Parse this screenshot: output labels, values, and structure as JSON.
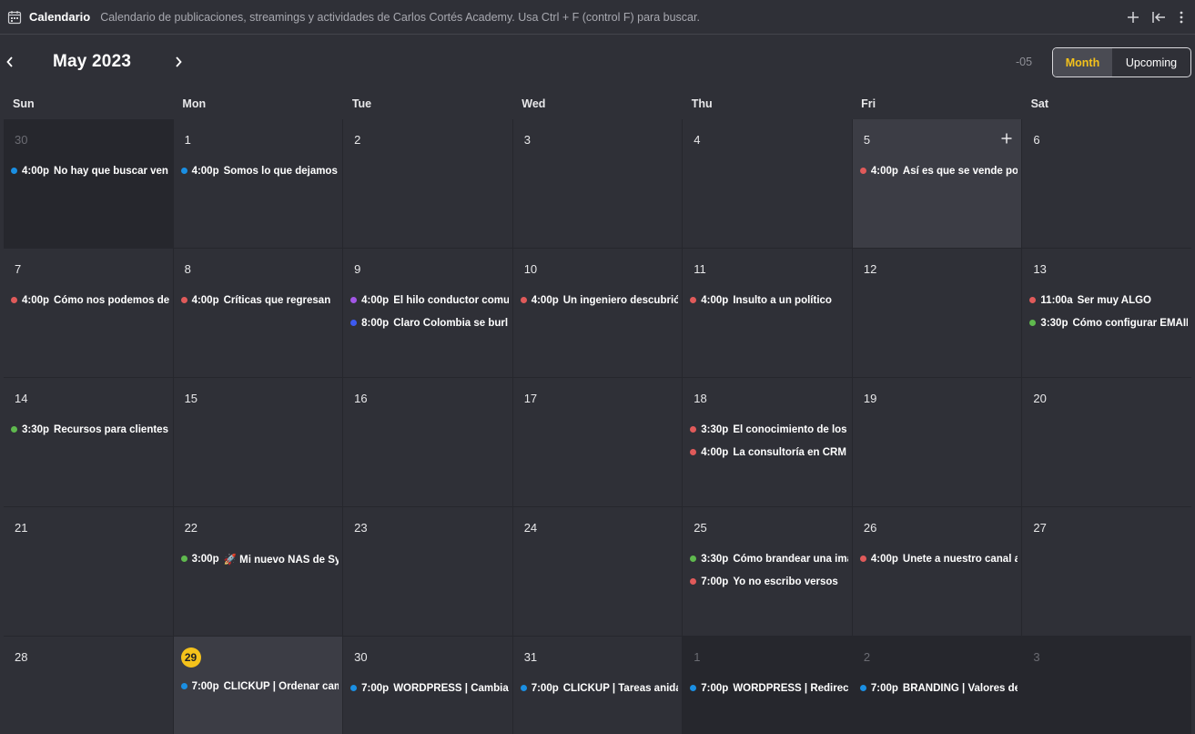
{
  "header": {
    "title": "Calendario",
    "description": "Calendario de publicaciones, streamings y actividades de Carlos Cortés Academy. Usa Ctrl + F (control F) para buscar."
  },
  "nav": {
    "month_title": "May 2023",
    "timezone": "-05",
    "view_month_label": "Month",
    "view_upcoming_label": "Upcoming"
  },
  "weekdays": [
    "Sun",
    "Mon",
    "Tue",
    "Wed",
    "Thu",
    "Fri",
    "Sat"
  ],
  "colors": {
    "blue": "#1a8fe3",
    "red": "#e05a5a",
    "purple": "#a256e6",
    "indigo": "#3d5af1",
    "green": "#5fb94e",
    "accent": "#f4c21b"
  },
  "days": [
    {
      "num": "30",
      "out": true,
      "events": [
        {
          "time": "4:00p",
          "title": "No hay que buscar ven",
          "color": "blue"
        }
      ]
    },
    {
      "num": "1",
      "events": [
        {
          "time": "4:00p",
          "title": "Somos lo que dejamos",
          "color": "blue"
        }
      ]
    },
    {
      "num": "2",
      "events": []
    },
    {
      "num": "3",
      "events": []
    },
    {
      "num": "4",
      "events": []
    },
    {
      "num": "5",
      "hover": true,
      "events": [
        {
          "time": "4:00p",
          "title": "Así es que se vende po",
          "color": "red"
        }
      ]
    },
    {
      "num": "6",
      "events": []
    },
    {
      "num": "7",
      "events": [
        {
          "time": "4:00p",
          "title": "Cómo nos podemos de",
          "color": "red"
        }
      ]
    },
    {
      "num": "8",
      "events": [
        {
          "time": "4:00p",
          "title": "Críticas que regresan",
          "color": "red"
        }
      ]
    },
    {
      "num": "9",
      "events": [
        {
          "time": "4:00p",
          "title": "El hilo conductor comu",
          "color": "purple"
        },
        {
          "time": "8:00p",
          "title": "Claro Colombia se burl",
          "color": "indigo"
        }
      ]
    },
    {
      "num": "10",
      "events": [
        {
          "time": "4:00p",
          "title": "Un ingeniero descubrió",
          "color": "red"
        }
      ]
    },
    {
      "num": "11",
      "events": [
        {
          "time": "4:00p",
          "title": "Insulto a un político",
          "color": "red"
        }
      ]
    },
    {
      "num": "12",
      "events": []
    },
    {
      "num": "13",
      "events": [
        {
          "time": "11:00a",
          "title": "Ser muy ALGO",
          "color": "red"
        },
        {
          "time": "3:30p",
          "title": "Cómo configurar EMAIL",
          "color": "green"
        }
      ]
    },
    {
      "num": "14",
      "events": [
        {
          "time": "3:30p",
          "title": "Recursos para clientes",
          "color": "green"
        }
      ]
    },
    {
      "num": "15",
      "events": []
    },
    {
      "num": "16",
      "events": []
    },
    {
      "num": "17",
      "events": []
    },
    {
      "num": "18",
      "events": [
        {
          "time": "3:30p",
          "title": "El conocimiento de los",
          "color": "red"
        },
        {
          "time": "4:00p",
          "title": "La consultoría en CRM",
          "color": "red"
        }
      ]
    },
    {
      "num": "19",
      "events": []
    },
    {
      "num": "20",
      "events": []
    },
    {
      "num": "21",
      "events": []
    },
    {
      "num": "22",
      "events": [
        {
          "time": "3:00p",
          "title": "🚀 Mi nuevo NAS de Sy",
          "color": "green"
        }
      ]
    },
    {
      "num": "23",
      "events": []
    },
    {
      "num": "24",
      "events": []
    },
    {
      "num": "25",
      "events": [
        {
          "time": "3:30p",
          "title": "Cómo brandear una ima",
          "color": "green"
        },
        {
          "time": "7:00p",
          "title": "Yo no escribo versos",
          "color": "red"
        }
      ]
    },
    {
      "num": "26",
      "events": [
        {
          "time": "4:00p",
          "title": "Únete a nuestro canal a",
          "color": "red"
        }
      ]
    },
    {
      "num": "27",
      "events": []
    },
    {
      "num": "28",
      "events": []
    },
    {
      "num": "29",
      "today": true,
      "events": [
        {
          "time": "7:00p",
          "title": "CLICKUP | Ordenar cam",
          "color": "blue"
        }
      ]
    },
    {
      "num": "30",
      "events": [
        {
          "time": "7:00p",
          "title": "WORDPRESS | Cambiar",
          "color": "blue"
        }
      ]
    },
    {
      "num": "31",
      "events": [
        {
          "time": "7:00p",
          "title": "CLICKUP | Tareas anida",
          "color": "blue"
        }
      ]
    },
    {
      "num": "1",
      "out": true,
      "events": [
        {
          "time": "7:00p",
          "title": "WORDPRESS | Redirecc",
          "color": "blue"
        }
      ]
    },
    {
      "num": "2",
      "out": true,
      "events": [
        {
          "time": "7:00p",
          "title": "BRANDING | Valores de",
          "color": "blue"
        }
      ]
    },
    {
      "num": "3",
      "out": true,
      "events": []
    }
  ]
}
